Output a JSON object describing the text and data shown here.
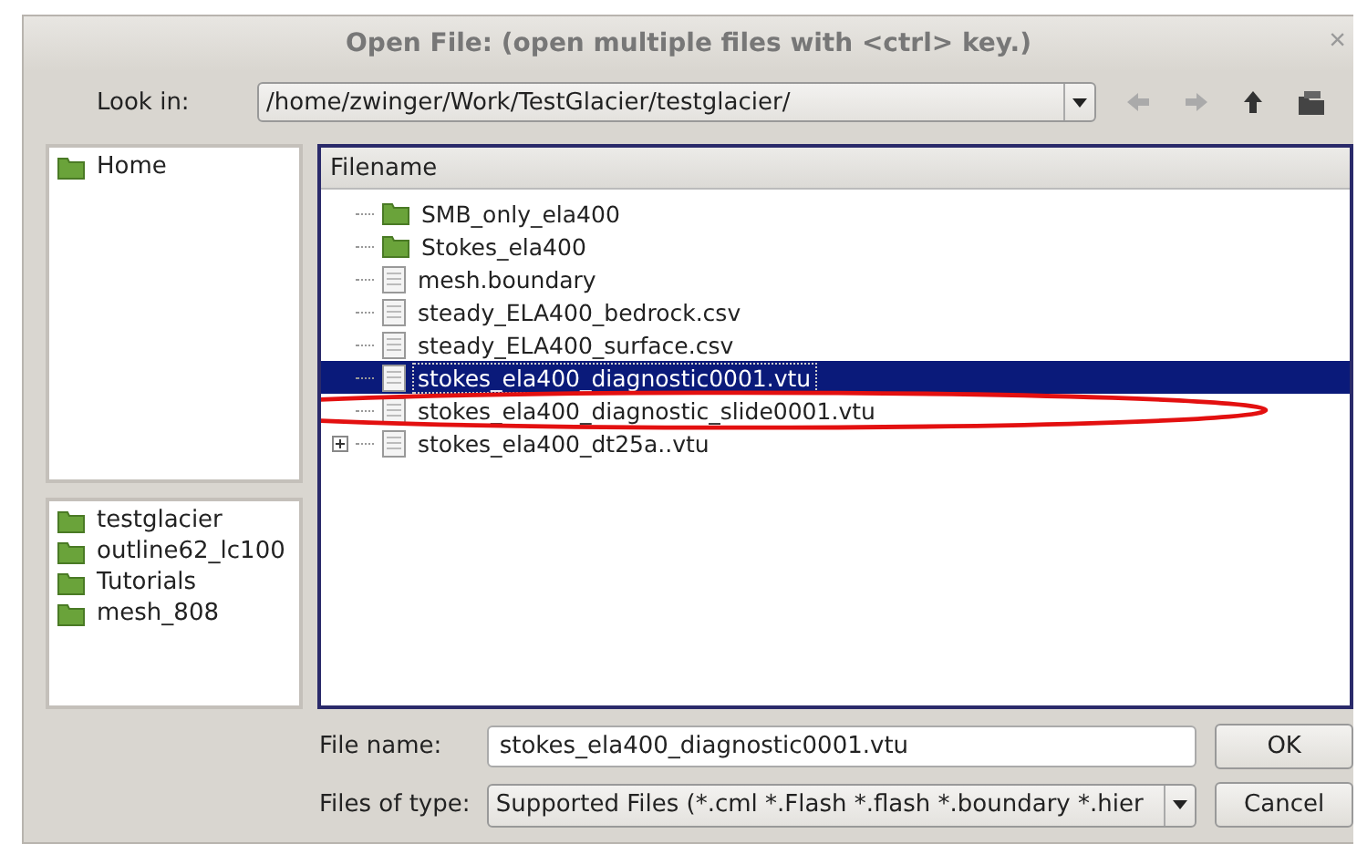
{
  "window": {
    "title": "Open File:  (open multiple files with <ctrl> key.)",
    "close": "×"
  },
  "look_in": {
    "label": "Look in:",
    "value": "/home/zwinger/Work/TestGlacier/testglacier/"
  },
  "places": [
    {
      "label": "Home",
      "selected": false
    }
  ],
  "recent": [
    {
      "label": "testglacier",
      "selected": false
    },
    {
      "label": "outline62_lc100",
      "selected": false
    },
    {
      "label": "Tutorials",
      "selected": false
    },
    {
      "label": "mesh_808",
      "selected": false
    }
  ],
  "file_list": {
    "column": "Filename",
    "rows": [
      {
        "name": "SMB_only_ela400",
        "kind": "folder",
        "selected": false,
        "expandable": false
      },
      {
        "name": "Stokes_ela400",
        "kind": "folder",
        "selected": false,
        "expandable": false
      },
      {
        "name": "mesh.boundary",
        "kind": "file",
        "selected": false,
        "expandable": false
      },
      {
        "name": "steady_ELA400_bedrock.csv",
        "kind": "file",
        "selected": false,
        "expandable": false
      },
      {
        "name": "steady_ELA400_surface.csv",
        "kind": "file",
        "selected": false,
        "expandable": false
      },
      {
        "name": "stokes_ela400_diagnostic0001.vtu",
        "kind": "file",
        "selected": true,
        "expandable": false
      },
      {
        "name": "stokes_ela400_diagnostic_slide0001.vtu",
        "kind": "file",
        "selected": false,
        "expandable": false
      },
      {
        "name": "stokes_ela400_dt25a..vtu",
        "kind": "file",
        "selected": false,
        "expandable": true
      }
    ]
  },
  "file_name": {
    "label": "File name:",
    "value": "stokes_ela400_diagnostic0001.vtu"
  },
  "file_type": {
    "label": "Files of type:",
    "value": "Supported Files (*.cml  *.Flash *.flash  *.boundary *.hier"
  },
  "buttons": [
    "OK",
    "Cancel"
  ]
}
